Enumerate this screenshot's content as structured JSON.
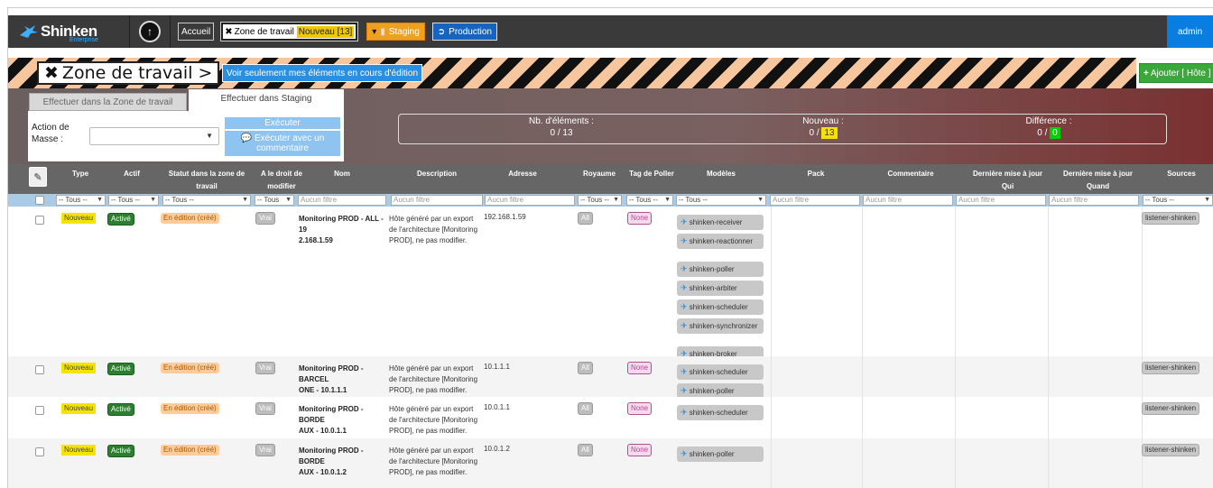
{
  "navbar": {
    "brand": "Shinken",
    "brand_sub": "Enterprise",
    "home": "Accueil",
    "zone_label": "Zone de travail",
    "zone_new": "Nouveau [13]",
    "staging": "Staging",
    "production": "Production",
    "user": "admin"
  },
  "zone": {
    "title": "Zone de travail >",
    "only_mine": "Voir seulement mes éléments en cours d'édition",
    "add": "Ajouter [ Hôte ]"
  },
  "tabs": {
    "zone": "Effectuer dans la Zone de travail",
    "staging": "Effectuer dans Staging"
  },
  "mass": {
    "label": "Action de Masse :",
    "execute": "Exécuter",
    "execute_comment_1": "Exécuter avec un",
    "execute_comment_2": "commentaire"
  },
  "counters": {
    "count_label": "Nb. d'éléments :",
    "count_value": "0 / 13",
    "new_label": "Nouveau :",
    "new_prefix": "0 /",
    "new_value": "13",
    "diff_label": "Différence :",
    "diff_prefix": "0 /",
    "diff_value": "0"
  },
  "columns": {
    "type": "Type",
    "actif": "Actif",
    "statut": "Statut dans la zone de travail",
    "droit_1": "A le droit de",
    "droit_2": "modifier",
    "nom": "Nom",
    "description": "Description",
    "adresse": "Adresse",
    "royaume": "Royaume",
    "tag": "Tag de Poller",
    "modeles": "Modèles",
    "pack": "Pack",
    "commentaire": "Commentaire",
    "qui_1": "Dernière mise à jour",
    "qui_2": "Qui",
    "quand_1": "Dernière mise à jour",
    "quand_2": "Quand",
    "sources": "Sources"
  },
  "filters": {
    "all_short": "-- Tous --",
    "all_tous": "-- Tous",
    "no_filter": "Aucun filtre"
  },
  "rows": [
    {
      "type": "Nouveau",
      "actif": "Activé",
      "statut": "En édition (créé)",
      "droit": "Vrai",
      "name_1": "Monitoring PROD - ALL - 19",
      "name_2": "2.168.1.59",
      "desc_1": "Hôte généré par un export",
      "desc_2": "de l'architecture [Monitoring",
      "desc_3": "PROD], ne pas modifier.",
      "adresse": "192.168.1.59",
      "royaume": "All",
      "tag": "None",
      "models": [
        "shinken-receiver",
        "shinken-reactionner",
        "shinken-poller",
        "shinken-arbiter",
        "shinken-scheduler",
        "shinken-synchronizer",
        "shinken-broker"
      ],
      "source": "listener-shinken"
    },
    {
      "type": "Nouveau",
      "actif": "Activé",
      "statut": "En édition (créé)",
      "droit": "Vrai",
      "name_1": "Monitoring PROD - BARCEL",
      "name_2": "ONE - 10.1.1.1",
      "desc_1": "Hôte généré par un export",
      "desc_2": "de l'architecture [Monitoring",
      "desc_3": "PROD], ne pas modifier.",
      "adresse": "10.1.1.1",
      "royaume": "All",
      "tag": "None",
      "models": [
        "shinken-scheduler",
        "shinken-poller"
      ],
      "source": "listener-shinken"
    },
    {
      "type": "Nouveau",
      "actif": "Activé",
      "statut": "En édition (créé)",
      "droit": "Vrai",
      "name_1": "Monitoring PROD - BORDE",
      "name_2": "AUX - 10.0.1.1",
      "desc_1": "Hôte généré par un export",
      "desc_2": "de l'architecture [Monitoring",
      "desc_3": "PROD], ne pas modifier.",
      "adresse": "10.0.1.1",
      "royaume": "All",
      "tag": "None",
      "models": [
        "shinken-scheduler"
      ],
      "source": "listener-shinken"
    },
    {
      "type": "Nouveau",
      "actif": "Activé",
      "statut": "En édition (créé)",
      "droit": "Vrai",
      "name_1": "Monitoring PROD - BORDE",
      "name_2": "AUX - 10.0.1.2",
      "desc_1": "Hôte généré par un export",
      "desc_2": "de l'architecture [Monitoring",
      "desc_3": "PROD], ne pas modifier.",
      "adresse": "10.0.1.2",
      "royaume": "All",
      "tag": "None",
      "models": [
        "shinken-poller"
      ],
      "source": "listener-shinken"
    }
  ],
  "colors": {
    "navbar": "#3a3a3a",
    "accent": "#2a8fe0",
    "staging": "#f0a020",
    "production": "#1565c0",
    "new_badge": "#f5e400",
    "active_badge": "#2e7d32"
  }
}
